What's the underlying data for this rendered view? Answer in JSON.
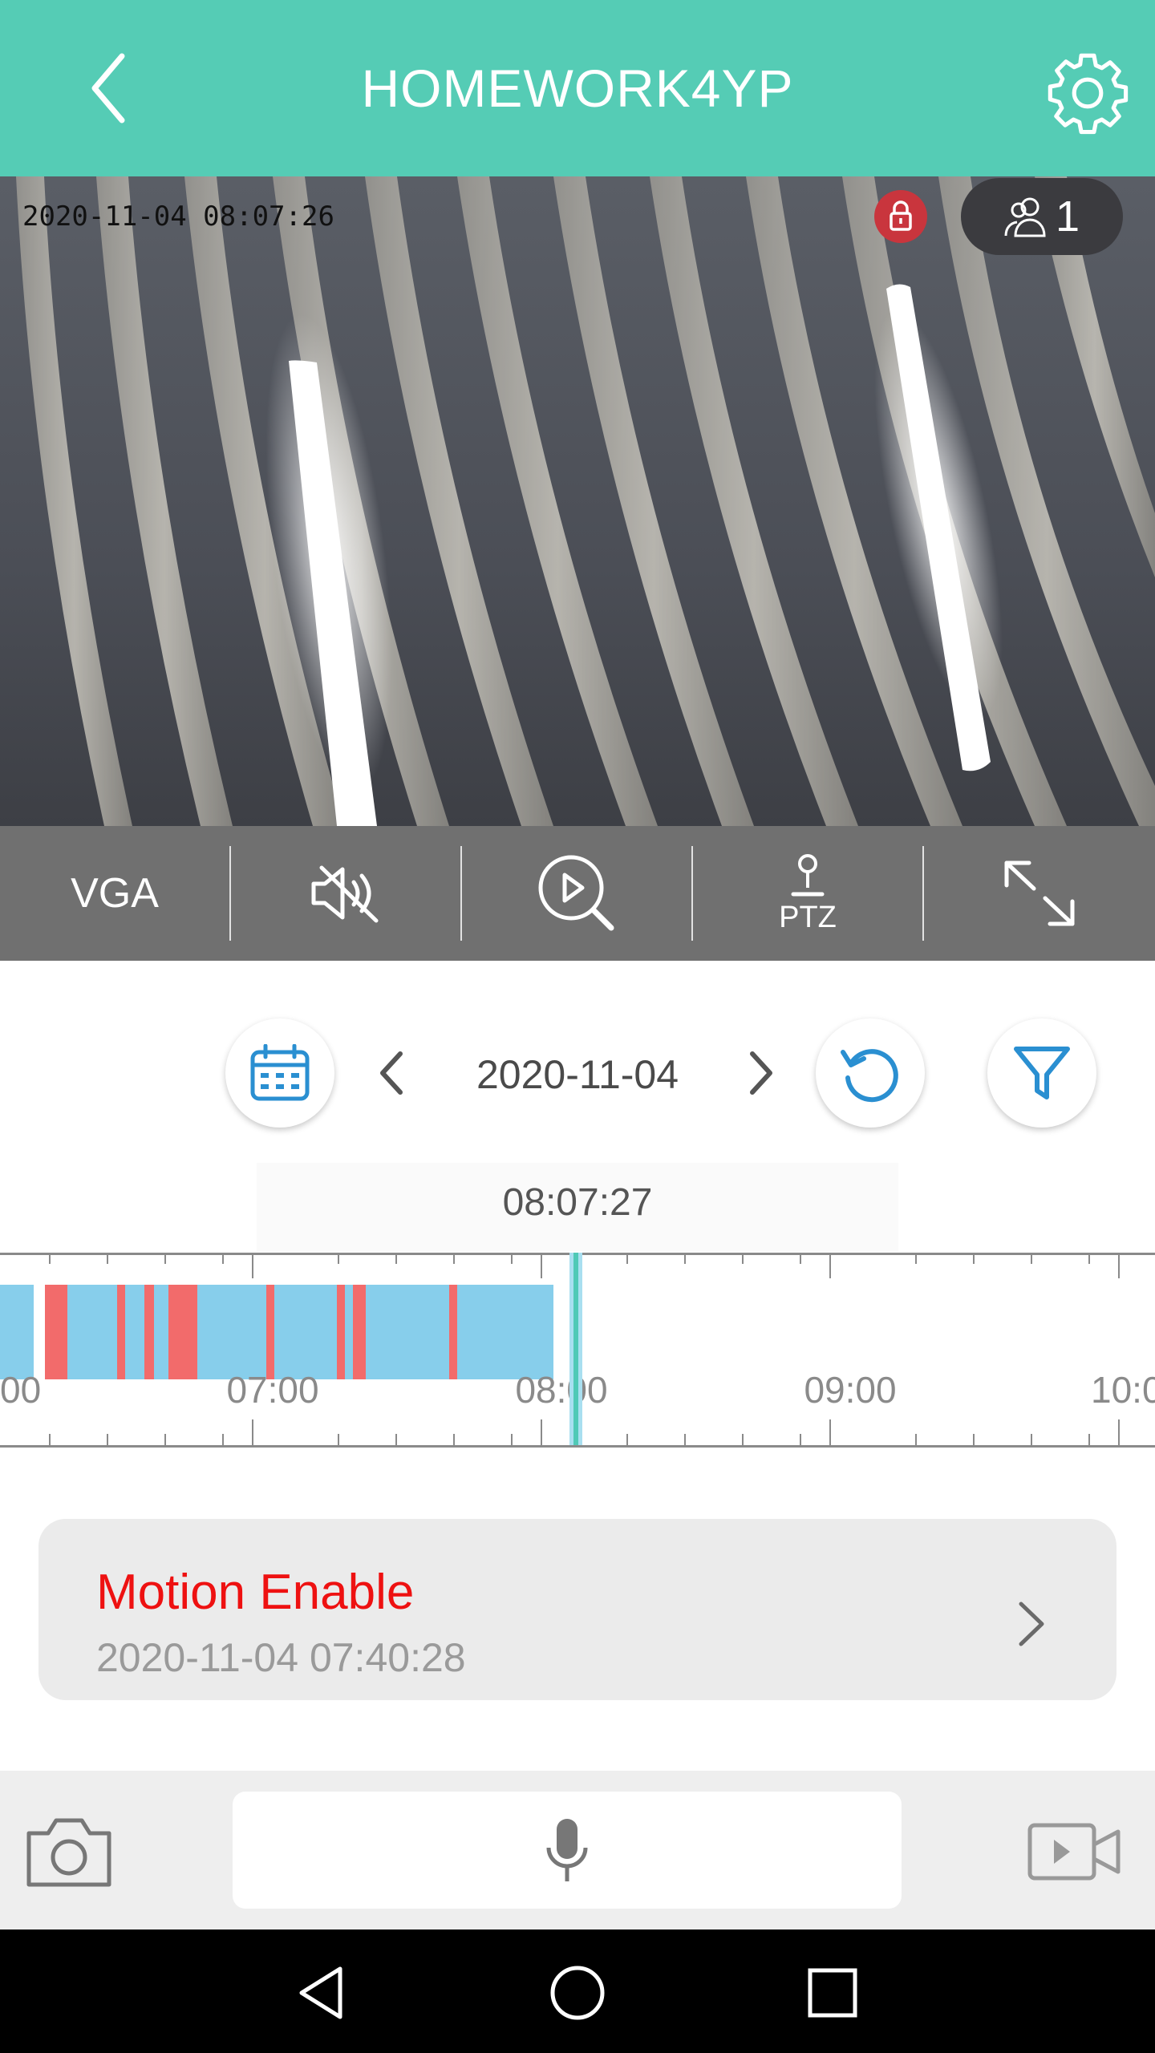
{
  "header": {
    "title": "HOMEWORK4YP"
  },
  "video": {
    "timestamp_overlay": "2020-11-04 08:07:26",
    "viewer_count": "1"
  },
  "controls": {
    "resolution_label": "VGA",
    "ptz_label": "PTZ"
  },
  "date_nav": {
    "date": "2020-11-04"
  },
  "timeline": {
    "current_time": "08:07:27",
    "hour_labels": [
      "00",
      "07:00",
      "08:00",
      "09:00",
      "10:0"
    ]
  },
  "event": {
    "title": "Motion Enable",
    "time": "2020-11-04 07:40:28"
  },
  "colors": {
    "accent": "#55ccb5",
    "recording": "#87ceeb",
    "motion": "#f26b6b",
    "event_title": "#ee1111"
  },
  "icons": [
    "back-arrow-icon",
    "gear-icon",
    "lock-icon",
    "people-icon",
    "mute-icon",
    "search-playback-icon",
    "ptz-joystick-icon",
    "expand-icon",
    "calendar-icon",
    "chevron-left-icon",
    "chevron-right-icon",
    "refresh-icon",
    "filter-icon",
    "camera-icon",
    "mic-icon",
    "video-record-icon",
    "nav-back-icon",
    "nav-home-icon",
    "nav-recents-icon"
  ]
}
